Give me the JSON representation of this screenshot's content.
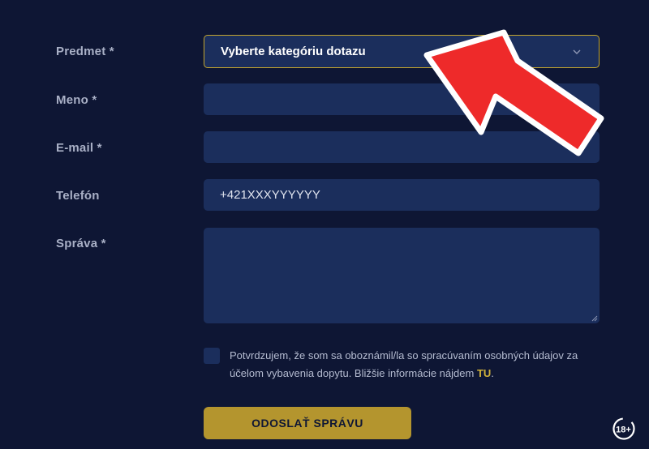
{
  "form": {
    "subject": {
      "label": "Predmet *",
      "placeholder": "Vyberte kategóriu dotazu"
    },
    "name": {
      "label": "Meno *",
      "value": ""
    },
    "email": {
      "label": "E-mail *",
      "value": ""
    },
    "phone": {
      "label": "Telefón",
      "placeholder": "+421XXXYYYYYY"
    },
    "message": {
      "label": "Správa *",
      "value": ""
    },
    "consent": {
      "text": "Potvrdzujem, že som sa oboznámil/la so spracúvaním osobných údajov za účelom vybavenia dopytu. Bližšie informácie nájdem ",
      "link": "TU",
      "suffix": "."
    },
    "submit_label": "ODOSLAŤ SPRÁVU"
  },
  "age_badge": "18+",
  "colors": {
    "background": "#0e1634",
    "field": "#1b2e5c",
    "accent_gold": "#b4952e",
    "arrow_red": "#ee2a2a"
  },
  "icons": [
    "chevron-down-icon",
    "red-arrow-pointer",
    "age-18-plus-icon"
  ]
}
